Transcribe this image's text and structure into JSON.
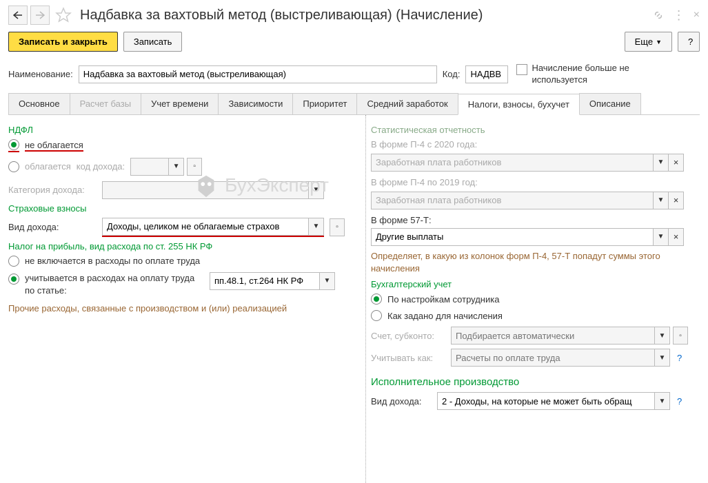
{
  "header": {
    "title": "Надбавка за вахтовый метод (выстреливающая) (Начисление)"
  },
  "actions": {
    "save_close": "Записать и закрыть",
    "save": "Записать",
    "more": "Еще",
    "help": "?"
  },
  "form": {
    "name_label": "Наименование:",
    "name_value": "Надбавка за вахтовый метод (выстреливающая)",
    "code_label": "Код:",
    "code_value": "НАДВВ",
    "notused_label": "Начисление больше не используется"
  },
  "tabs": [
    {
      "label": "Основное"
    },
    {
      "label": "Расчет базы"
    },
    {
      "label": "Учет времени"
    },
    {
      "label": "Зависимости"
    },
    {
      "label": "Приоритет"
    },
    {
      "label": "Средний заработок"
    },
    {
      "label": "Налоги, взносы, бухучет"
    },
    {
      "label": "Описание"
    }
  ],
  "left": {
    "ndfl_title": "НДФЛ",
    "not_taxed": "не облагается",
    "taxed": "облагается",
    "income_code_label": "код дохода:",
    "income_category_label": "Категория дохода:",
    "insurance_title": "Страховые взносы",
    "income_type_label": "Вид дохода:",
    "income_type_value": "Доходы, целиком не облагаемые страхов",
    "profit_tax_title": "Налог на прибыль, вид расхода по ст. 255 НК РФ",
    "not_included": "не включается в расходы по оплате труда",
    "included": "учитывается в расходах на оплату труда по статье:",
    "article_value": "пп.48.1, ст.264 НК РФ",
    "other_expenses": "Прочие расходы, связанные с производством и (или) реализацией"
  },
  "right": {
    "stat_title": "Статистическая отчетность",
    "p4_2020_label": "В форме П-4 с 2020 года:",
    "p4_2020_value": "Заработная плата работников",
    "p4_2019_label": "В форме П-4 по 2019 год:",
    "p4_2019_value": "Заработная плата работников",
    "f57t_label": "В форме 57-Т:",
    "f57t_value": "Другие выплаты",
    "note": "Определяет, в какую из колонок форм П-4, 57-Т попадут суммы этого начисления",
    "accounting_title": "Бухгалтерский учет",
    "by_employee": "По настройкам сотрудника",
    "by_accrual": "Как задано для начисления",
    "account_label": "Счет, субконто:",
    "account_placeholder": "Подбирается автоматически",
    "consider_label": "Учитывать как:",
    "consider_placeholder": "Расчеты по оплате труда",
    "enforcement_title": "Исполнительное производство",
    "enforce_label": "Вид дохода:",
    "enforce_value": "2 - Доходы, на которые не может быть обращ"
  }
}
